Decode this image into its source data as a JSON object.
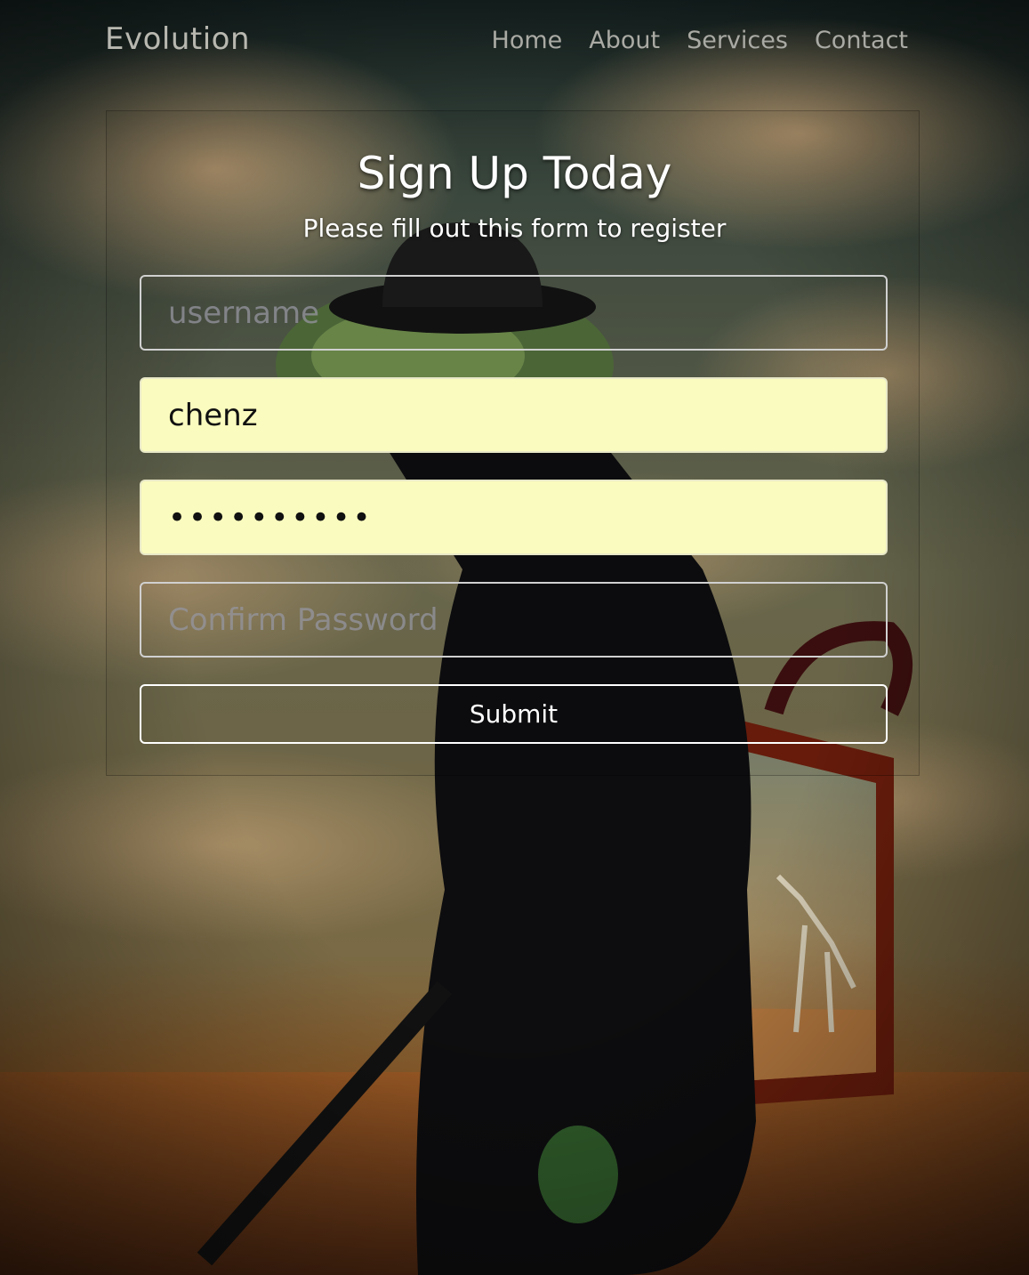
{
  "navbar": {
    "brand": "Evolution",
    "links": [
      "Home",
      "About",
      "Services",
      "Contact"
    ]
  },
  "form": {
    "title": "Sign Up Today",
    "subtitle": "Please fill out this form to register",
    "username_placeholder": "username",
    "name_value": "chenz",
    "password_value": "••••••••••",
    "confirm_placeholder": "Confirm Password",
    "submit_label": "Submit"
  },
  "colors": {
    "autofill_bg": "#fafbbe",
    "text_on_bg": "#ffffff",
    "nav_text": "#aaaaa4"
  }
}
